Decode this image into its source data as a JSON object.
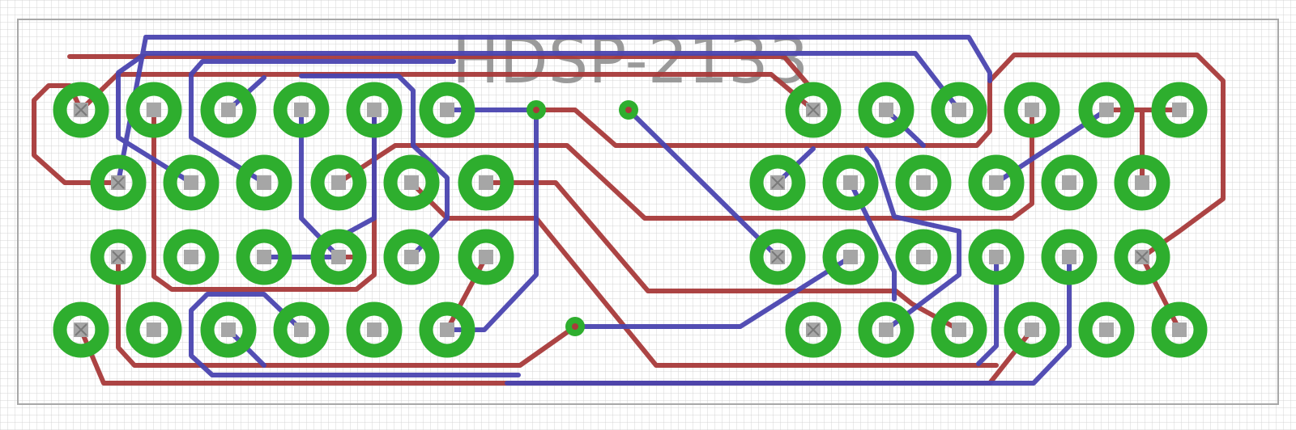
{
  "board": {
    "silkscreen_label": "HDSP-2133"
  },
  "colors": {
    "background": "#ffffff",
    "grid": "#d4d4d4",
    "grid_major": "#c4c4c4",
    "outline": "#a8a8a8",
    "pad": "#2eae2e",
    "drill": "#a6a6a6",
    "top_trace": "#a83a3a",
    "bottom_trace": "#4a45b0",
    "silkscreen": "#8a8a8a"
  },
  "legend": {
    "pad_icon": "green-ring-pad",
    "via_icon": "small-green-via",
    "trace_top": "red-copper-trace",
    "trace_bottom": "blue-copper-trace"
  }
}
